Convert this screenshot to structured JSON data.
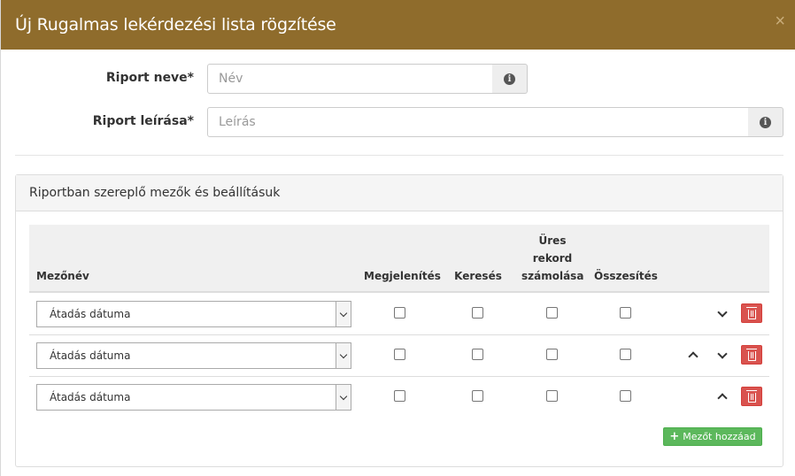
{
  "modal": {
    "title": "Új Rugalmas lekérdezési lista rögzítése",
    "close_glyph": "×"
  },
  "form": {
    "name_label": "Riport neve*",
    "name_placeholder": "Név",
    "name_value": "",
    "description_label": "Riport leírása*",
    "description_placeholder": "Leírás",
    "description_value": "",
    "info_icon": "info-circle-icon",
    "info_glyph": "i"
  },
  "panel": {
    "title": "Riportban szereplő mezők és beállításuk",
    "columns": {
      "field_name": "Mezőnév",
      "display": "Megjelenítés",
      "search": "Keresés",
      "empty_line1": "Üres",
      "empty_line2": "rekord",
      "empty_line3": "számolása",
      "summary": "Összesítés"
    },
    "rows": [
      {
        "field": "Átadás dátuma",
        "display": false,
        "search": false,
        "count_empty": false,
        "summary": false,
        "can_move_up": false,
        "can_move_down": true
      },
      {
        "field": "Átadás dátuma",
        "display": false,
        "search": false,
        "count_empty": false,
        "summary": false,
        "can_move_up": true,
        "can_move_down": true
      },
      {
        "field": "Átadás dátuma",
        "display": false,
        "search": false,
        "count_empty": false,
        "summary": false,
        "can_move_up": true,
        "can_move_down": false
      }
    ],
    "add_button": "Mezőt hozzáad",
    "add_glyph": "+"
  },
  "colors": {
    "header": "#8f6c2c",
    "danger": "#d9534f",
    "success": "#5cb85c"
  }
}
